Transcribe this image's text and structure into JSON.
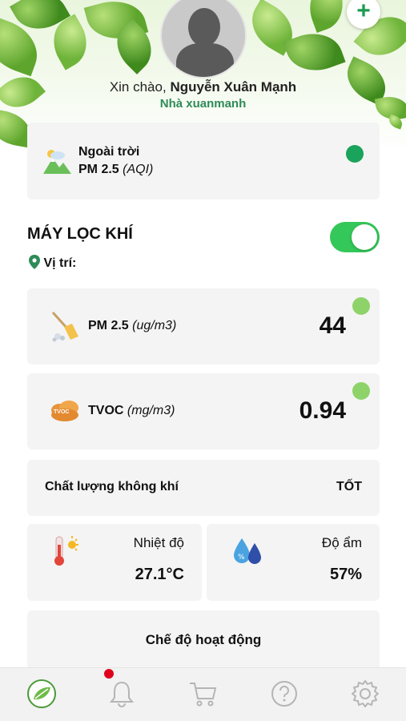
{
  "header": {
    "greeting_prefix": "Xin chào,",
    "user_name": "Nguyễn Xuân Mạnh",
    "home_name": "Nhà xuanmanh",
    "add_label": "+"
  },
  "outdoor": {
    "title": "Ngoài trời",
    "metric": "PM 2.5",
    "unit": "(AQI)",
    "status_color": "#1aa35a",
    "icon": "mountain-sun-icon"
  },
  "device": {
    "title": "MÁY LỌC KHÍ",
    "location_label": "Vị trí:",
    "power_on": true,
    "toggle_color": "#34c759"
  },
  "pm25": {
    "label": "PM 2.5",
    "unit": "(ug/m3)",
    "value": "44",
    "status_color": "#8ed36a",
    "icon": "broom-dust-icon"
  },
  "tvoc": {
    "label": "TVOC",
    "unit": "(mg/m3)",
    "value": "0.94",
    "status_color": "#8ed36a",
    "icon": "tvoc-cloud-icon",
    "icon_text": "TVOC"
  },
  "air_quality": {
    "label": "Chất lượng không khí",
    "value": "TỐT"
  },
  "temperature": {
    "label": "Nhiệt độ",
    "value": "27.1°C",
    "icon": "thermometer-sun-icon"
  },
  "humidity": {
    "label": "Độ ẩm",
    "value": "57%",
    "icon": "water-drops-icon"
  },
  "mode": {
    "label": "Chế độ hoạt động"
  },
  "tabbar": {
    "items": [
      {
        "name": "home",
        "icon": "leaf-logo-icon",
        "active": true
      },
      {
        "name": "notifications",
        "icon": "bell-icon",
        "badge_color": "#e0001b"
      },
      {
        "name": "shop",
        "icon": "cart-icon"
      },
      {
        "name": "help",
        "icon": "question-icon"
      },
      {
        "name": "settings",
        "icon": "gear-icon"
      }
    ]
  }
}
